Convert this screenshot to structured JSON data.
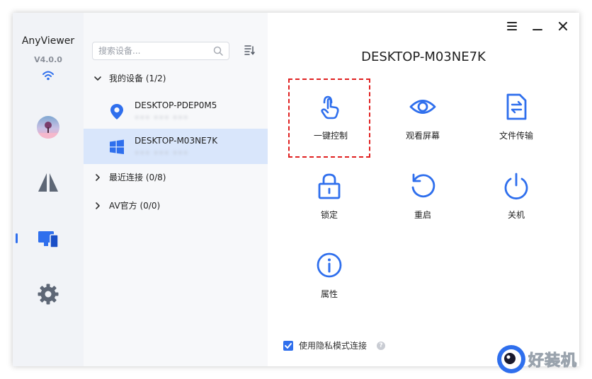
{
  "app": {
    "name": "AnyViewer",
    "version": "V4.0.0"
  },
  "colors": {
    "accent": "#2f6fed",
    "selected_row": "#d9e6fb",
    "highlight_border": "#e02020"
  },
  "sidebar": {
    "items": [
      {
        "icon": "avatar"
      },
      {
        "icon": "connect-icon"
      },
      {
        "icon": "devices-icon",
        "active": true
      },
      {
        "icon": "gear-icon"
      }
    ]
  },
  "search": {
    "placeholder": "搜索设备..."
  },
  "groups": {
    "my_devices": "我的设备 (1/2)",
    "recent": "最近连接 (0/8)",
    "official": "AV官方 (0/0)"
  },
  "devices": [
    {
      "name": "DESKTOP-PDEP0M5",
      "id": "••• ••• •••",
      "icon": "location-pin-icon"
    },
    {
      "name": "DESKTOP-M03NE7K",
      "id": "••• ••• •••",
      "icon": "windows-logo-icon",
      "selected": true
    }
  ],
  "main": {
    "title": "DESKTOP-M03NE7K",
    "actions": [
      {
        "label": "一键控制",
        "icon": "touch-hand-icon",
        "highlighted": true
      },
      {
        "label": "观看屏幕",
        "icon": "eye-icon"
      },
      {
        "label": "文件传输",
        "icon": "file-transfer-icon"
      },
      {
        "label": "锁定",
        "icon": "lock-icon"
      },
      {
        "label": "重启",
        "icon": "restart-icon"
      },
      {
        "label": "关机",
        "icon": "power-icon"
      },
      {
        "label": "属性",
        "icon": "info-icon"
      }
    ],
    "privacy": {
      "label": "使用隐私模式连接",
      "checked": true
    }
  },
  "watermark": {
    "text": "好装机"
  }
}
